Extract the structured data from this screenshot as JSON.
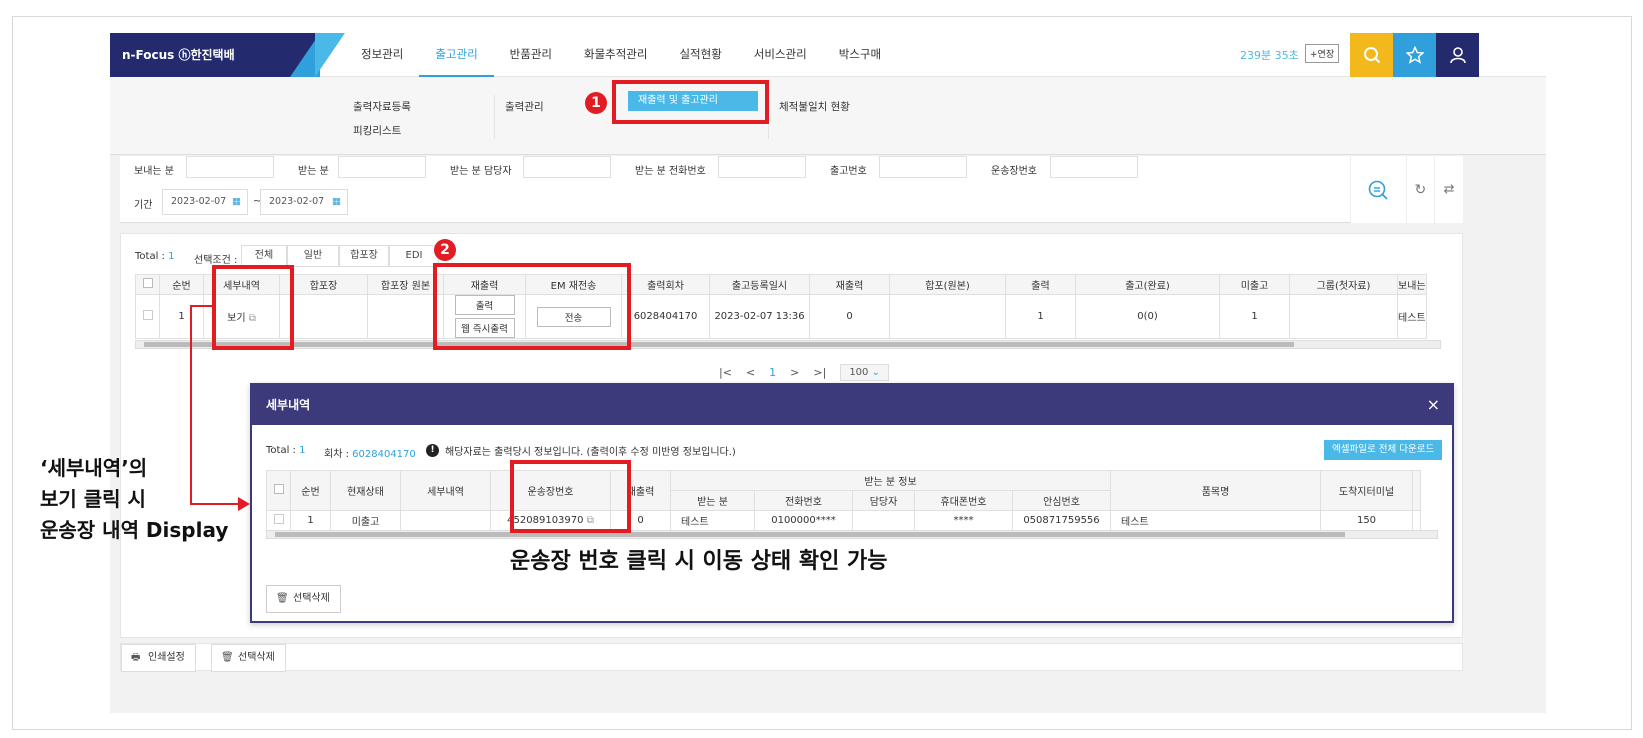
{
  "app": {
    "logo": "n-Focus ⓗ한진택배",
    "menu": [
      "정보관리",
      "출고관리",
      "반품관리",
      "화물추적관리",
      "실적현황",
      "서비스관리",
      "박스구매"
    ],
    "timer": "239분 35초",
    "extend_label": "+연장"
  },
  "submenu": {
    "col1": [
      "출력자료등록",
      "피킹리스트"
    ],
    "col2": [
      "출력관리"
    ],
    "active": "재출력 및 출고관리",
    "col4": [
      "체적불일치 현황"
    ]
  },
  "filter": {
    "sender": "보내는 분",
    "receiver": "받는 분",
    "receiver_manager": "받는 분 담당자",
    "receiver_phone": "받는 분 전화번호",
    "release_no": "출고번호",
    "waybill_no": "운송장번호",
    "period_label": "기간",
    "date_from": "2023-02-07",
    "date_to": "2023-02-07",
    "tilde": "~"
  },
  "results": {
    "total_label": "Total : ",
    "total_value": "1",
    "condition_label": "선택조건 :",
    "tabs": [
      "전체",
      "일반",
      "합포장",
      "EDI"
    ],
    "columns": [
      "순번",
      "세부내역",
      "합포장",
      "합포장 원본",
      "재출력",
      "EM 재전송",
      "출력회차",
      "출고등록일시",
      "재출력",
      "합포(원본)",
      "출력",
      "출고(완료)",
      "미출고",
      "그룹(첫자료)",
      "보내는"
    ],
    "row": {
      "no": "1",
      "detail": "보기",
      "print_btn": "출력",
      "web_print_btn": "웹 즉시출력",
      "resend_btn": "전송",
      "print_round": "6028404170",
      "reg_date": "2023-02-07 13:36",
      "reprint": "0",
      "print": "1",
      "released": "0(0)",
      "unreleased": "1",
      "sender": "테스트"
    },
    "pager": {
      "current": "1",
      "page_size": "100"
    }
  },
  "bottom": {
    "print_setting": "인쇄설정",
    "delete_selected": "선택삭제"
  },
  "modal": {
    "title": "세부내역",
    "close": "×",
    "total_label": "Total : ",
    "total_value": "1",
    "round_label": "회차 : ",
    "round_value": "6028404170",
    "notice": "해당자료는 출력당시 정보입니다. (출력이후 수정 미반영 정보입니다.)",
    "excel_btn": "엑셀파일로 전체 다운로드",
    "group_header": "받는 분 정보",
    "columns": [
      "순번",
      "현재상태",
      "세부내역",
      "운송장번호",
      "재출력",
      "받는 분",
      "전화번호",
      "담당자",
      "휴대폰번호",
      "안심번호",
      "품목명",
      "도착지터미널"
    ],
    "row": {
      "no": "1",
      "status": "미출고",
      "detail": "",
      "waybill": "452089103970",
      "reprint": "0",
      "receiver": "테스트",
      "phone": "0100000****",
      "manager": "",
      "mobile": "****",
      "safe_no": "050871759556",
      "item": "테스트",
      "terminal": "150"
    },
    "delete_btn": "선택삭제"
  },
  "annotations": {
    "badge1": "1",
    "badge2": "2",
    "left_note": [
      "‘세부내역’의",
      "보기 클릭 시",
      "운송장 내역 Display"
    ],
    "bottom_note": "운송장 번호 클릭 시  이동 상태 확인 가능"
  },
  "colors": {
    "navy": "#232a6e",
    "accent": "#2fa0dc",
    "highlight": "#e31b23",
    "modal": "#3c3a7a",
    "yellow_btn": "#f2b81c"
  }
}
